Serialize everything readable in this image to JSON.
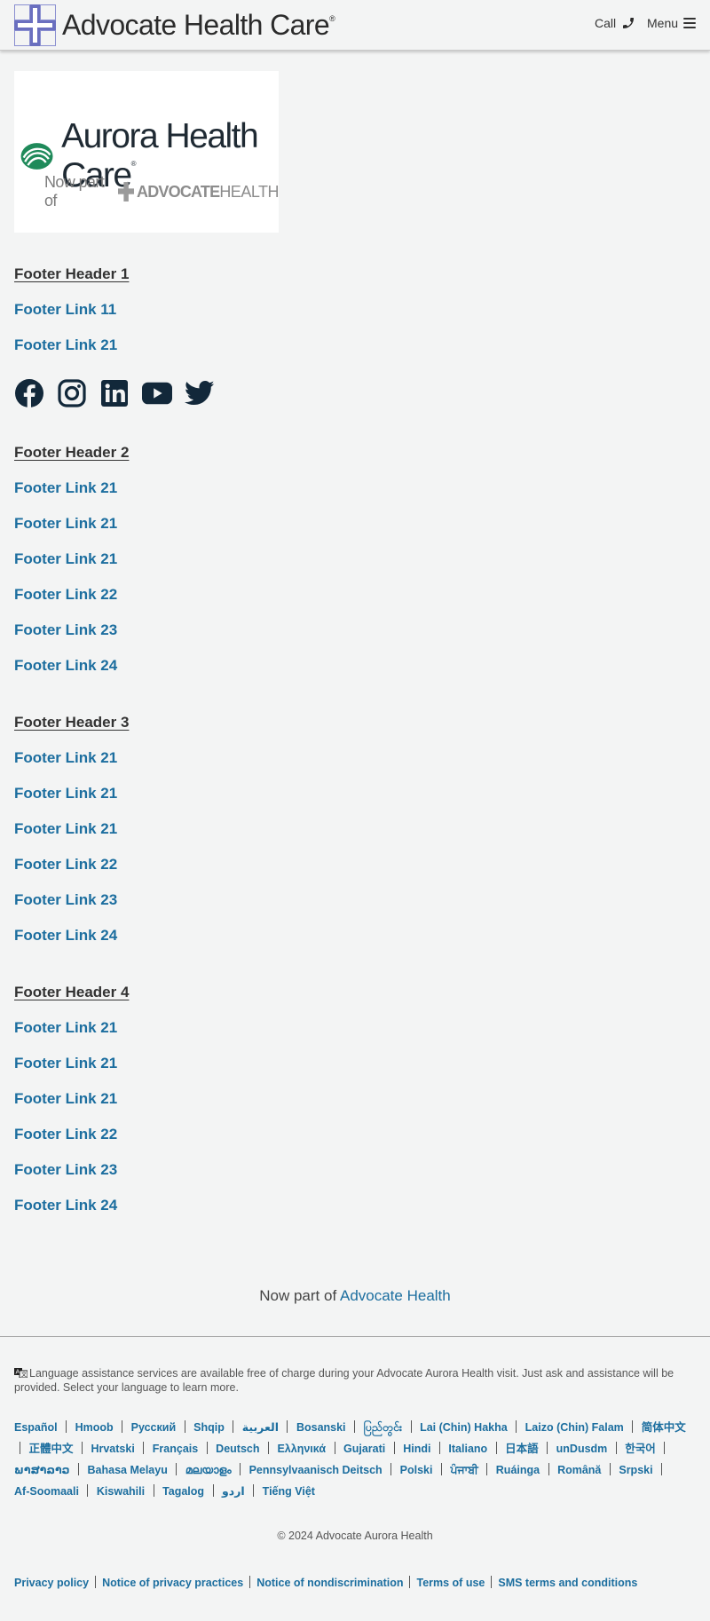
{
  "header": {
    "brand_name": "Advocate Health Care",
    "brand_reg": "®",
    "call_label": "Call",
    "menu_label": "Menu"
  },
  "logo": {
    "aurora_name": "Aurora Health Care",
    "aurora_reg": "®",
    "now_part_of": "Now part of",
    "advocate_word": "ADVOCATE",
    "health_word": "HEALTH"
  },
  "footer": {
    "sections": [
      {
        "header": "Footer Header 1",
        "links": [
          "Footer Link 11",
          "Footer Link 21"
        ]
      },
      {
        "header": "Footer Header 2",
        "links": [
          "Footer Link 21",
          "Footer Link 21",
          "Footer Link 21",
          "Footer Link 22",
          "Footer Link 23",
          "Footer Link 24"
        ]
      },
      {
        "header": "Footer Header 3",
        "links": [
          "Footer Link 21",
          "Footer Link 21",
          "Footer Link 21",
          "Footer Link 22",
          "Footer Link 23",
          "Footer Link 24"
        ]
      },
      {
        "header": "Footer Header 4",
        "links": [
          "Footer Link 21",
          "Footer Link 21",
          "Footer Link 21",
          "Footer Link 22",
          "Footer Link 23",
          "Footer Link 24"
        ]
      }
    ],
    "social_icons": [
      "facebook-icon",
      "instagram-icon",
      "linkedin-icon",
      "youtube-icon",
      "twitter-icon"
    ],
    "now_part_prefix": "Now part of",
    "now_part_link": "Advocate Health",
    "language_assist": "Language assistance services are available free of charge during your Advocate Aurora Health visit. Just ask and assistance will be provided. Select your language to learn more.",
    "languages": [
      "Español",
      "Hmoob",
      "Русский",
      "Shqip",
      "العربية",
      "Bosanski",
      "ပြည်တွင်း",
      "Lai (Chin) Hakha",
      "Laizo (Chin) Falam",
      "简体中文",
      "正體中文",
      "Hrvatski",
      "Français",
      "Deutsch",
      "Ελληνικά",
      "Gujarati",
      "Hindi",
      "Italiano",
      "日本語",
      "unDusdm",
      "한국어",
      "ພາສາລາວ",
      "Bahasa Melayu",
      "മലയാളം",
      "Pennsylvaanisch Deitsch",
      "Polski",
      "ਪੰਜਾਬੀ",
      "Ruáinga",
      "Română",
      "Srpski",
      "Af-Soomaali",
      "Kiswahili",
      "Tagalog",
      "اردو",
      "Tiếng Việt"
    ],
    "copyright": "© 2024 Advocate Aurora Health",
    "legal_links": [
      "Privacy policy",
      "Notice of privacy practices",
      "Notice of nondiscrimination",
      "Terms of use",
      "SMS terms and conditions"
    ]
  },
  "colors": {
    "link_blue": "#1c6e9f",
    "background": "#f3f4f4",
    "brand_purple": "#7b7fc4",
    "aurora_green": "#1f8a5a"
  }
}
